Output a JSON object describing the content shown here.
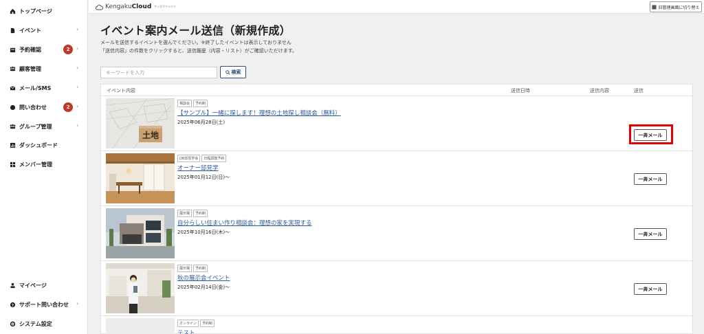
{
  "sidebar": {
    "items": [
      {
        "label": "トップページ",
        "icon": "home-icon"
      },
      {
        "label": "イベント",
        "icon": "document-icon",
        "chevron": "›"
      },
      {
        "label": "予約確認",
        "icon": "calendar-icon",
        "badge": "2",
        "chevron": "›"
      },
      {
        "label": "顧客管理",
        "icon": "people-icon",
        "chevron": "›"
      },
      {
        "label": "メール/SMS",
        "icon": "mail-icon",
        "chevron": "›"
      },
      {
        "label": "問い合わせ",
        "icon": "chat-icon",
        "badge": "2",
        "chevron": "›"
      },
      {
        "label": "グループ管理",
        "icon": "group-icon",
        "chevron": "›"
      },
      {
        "label": "ダッシュボード",
        "icon": "chart-icon"
      },
      {
        "label": "メンバー管理",
        "icon": "grid-icon"
      }
    ],
    "bottom_items": [
      {
        "label": "マイページ",
        "icon": "user-icon"
      },
      {
        "label": "サポート問い合わせ",
        "icon": "help-icon",
        "chevron": "›"
      },
      {
        "label": "システム設定",
        "icon": "gear-icon"
      }
    ],
    "badge_color": "#c0392b"
  },
  "header": {
    "brand_light": "Kengaku",
    "brand_bold": "Cloud",
    "brand_sub": "ケンガククラウド",
    "switch_label": "旧管理画面に切り替え"
  },
  "main": {
    "title": "イベント案内メール送信（新規作成）",
    "description_line1": "メールを送信するイベントを選んでください。※終了したイベントは表示しておりません",
    "description_line2": "「送信内容」の件数をクリックすると、送信履歴（内容・リスト）がご確認いただけます。",
    "search": {
      "placeholder": "キーワードを入力",
      "button_label": "検索"
    },
    "table": {
      "headers": {
        "event": "イベント内容",
        "send_datetime": "送信日時",
        "send_content": "送信内容",
        "send": "送信"
      },
      "rows": [
        {
          "tags": [
            "相談会",
            "予約制"
          ],
          "title": "【サンプル】一緒に探します！理想の土地探し相談会（無料）",
          "date": "2025年06月28日(土)",
          "button": "一斉メール",
          "highlighted": true
        },
        {
          "tags": [
            "OB邸見学会",
            "日程調整予約"
          ],
          "title": "オーナー邸見学",
          "date": "2025年01月12日(日)〜",
          "button": "一斉メール"
        },
        {
          "tags": [
            "展示場",
            "予約制"
          ],
          "title": "自分らしい住まい作り相談会：理想の家を実現する",
          "date": "2025年10月16日(木)〜",
          "button": "一斉メール"
        },
        {
          "tags": [
            "展示場",
            "予約制"
          ],
          "title": "秋の展示会イベント",
          "date": "2025年02月14日(金)〜",
          "button": "一斉メール"
        },
        {
          "tags": [
            "オンライン",
            "予約制"
          ],
          "title": "テスト",
          "date": "",
          "button": ""
        }
      ]
    },
    "link_color": "#2d5b9a",
    "highlight_color": "#e00000"
  }
}
